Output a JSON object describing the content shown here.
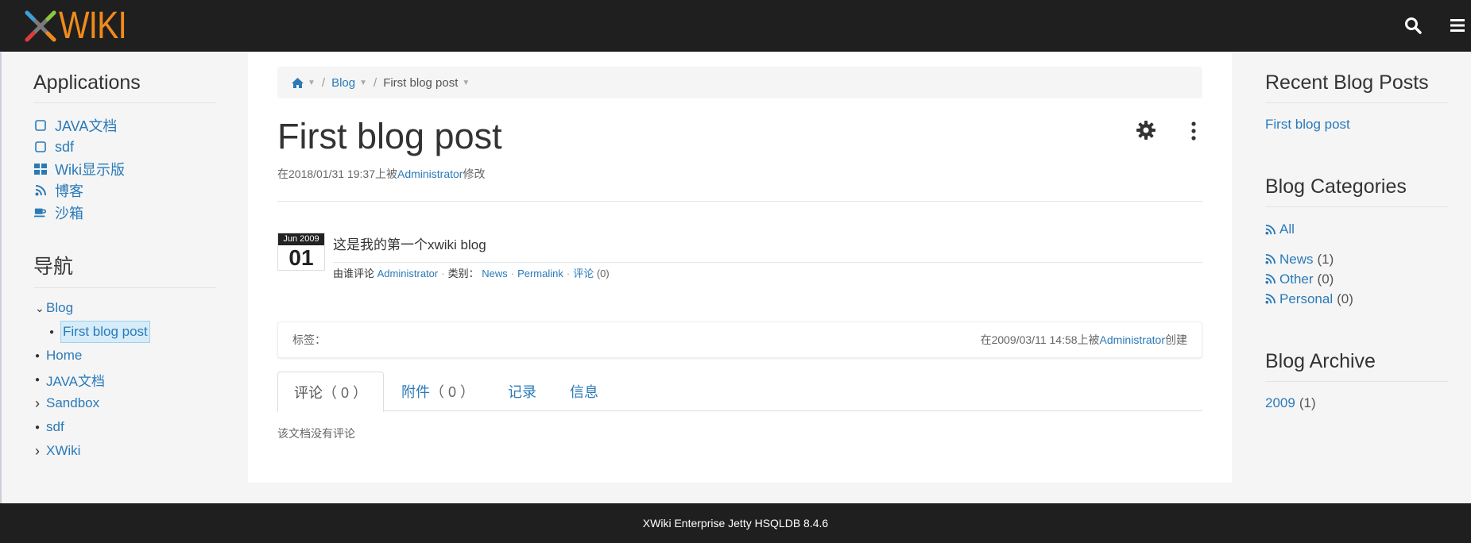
{
  "header": {
    "logo_text": "WIKI",
    "search_icon": "search-icon",
    "menu_icon": "hamburger-icon"
  },
  "left": {
    "apps_title": "Applications",
    "apps": [
      {
        "label": "JAVA文档",
        "icon": "square-icon"
      },
      {
        "label": "sdf",
        "icon": "square-icon"
      },
      {
        "label": "Wiki显示版",
        "icon": "dashboard-icon"
      },
      {
        "label": "博客",
        "icon": "rss-icon"
      },
      {
        "label": "沙箱",
        "icon": "coffee-icon"
      }
    ],
    "nav_title": "导航",
    "nav": [
      {
        "label": "Blog",
        "marker": "⌄"
      },
      {
        "label": "First blog post",
        "marker": "●"
      },
      {
        "label": "Home",
        "marker": "●"
      },
      {
        "label": "JAVA文档",
        "marker": "●"
      },
      {
        "label": "Sandbox",
        "marker": "›"
      },
      {
        "label": "sdf",
        "marker": "●"
      },
      {
        "label": "XWiki",
        "marker": "›"
      }
    ]
  },
  "main": {
    "breadcrumb": {
      "blog": "Blog",
      "current": "First blog post"
    },
    "title": "First blog post",
    "modified": {
      "prefix": "在2018/01/31 19:37上被",
      "user": "Administrator",
      "suffix": "修改"
    },
    "entry": {
      "month": "Jun 2009",
      "day": "01",
      "title": "这是我的第一个xwiki blog",
      "by": "由谁评论",
      "author": "Administrator",
      "category_label": "类别：",
      "category": "News",
      "permalink": "Permalink",
      "comments": "评论",
      "comment_count": "(0)"
    },
    "tags_label": "标签：",
    "created": {
      "prefix": "在2009/03/11 14:58上被",
      "user": "Administrator",
      "suffix": "创建"
    },
    "tabs": [
      {
        "label": "评论",
        "count": "（ 0 ）"
      },
      {
        "label": "附件",
        "count": "（ 0 ）"
      },
      {
        "label": "记录",
        "count": ""
      },
      {
        "label": "信息",
        "count": ""
      }
    ],
    "no_comments": "该文档没有评论"
  },
  "right": {
    "recent_title": "Recent Blog Posts",
    "recent_link": "First blog post",
    "cat_title": "Blog Categories",
    "cat_all": "All",
    "categories": [
      {
        "label": "News",
        "count": "(1)"
      },
      {
        "label": "Other",
        "count": "(0)"
      },
      {
        "label": "Personal",
        "count": "(0)"
      }
    ],
    "archive_title": "Blog Archive",
    "archive_year": "2009",
    "archive_count": "(1)"
  },
  "footer": {
    "text": "XWiki Enterprise Jetty HSQLDB 8.4.6"
  },
  "colors": {
    "link": "#2a7ab8",
    "logo_orange": "#f08a1c",
    "topbar": "#1f1f1f"
  }
}
